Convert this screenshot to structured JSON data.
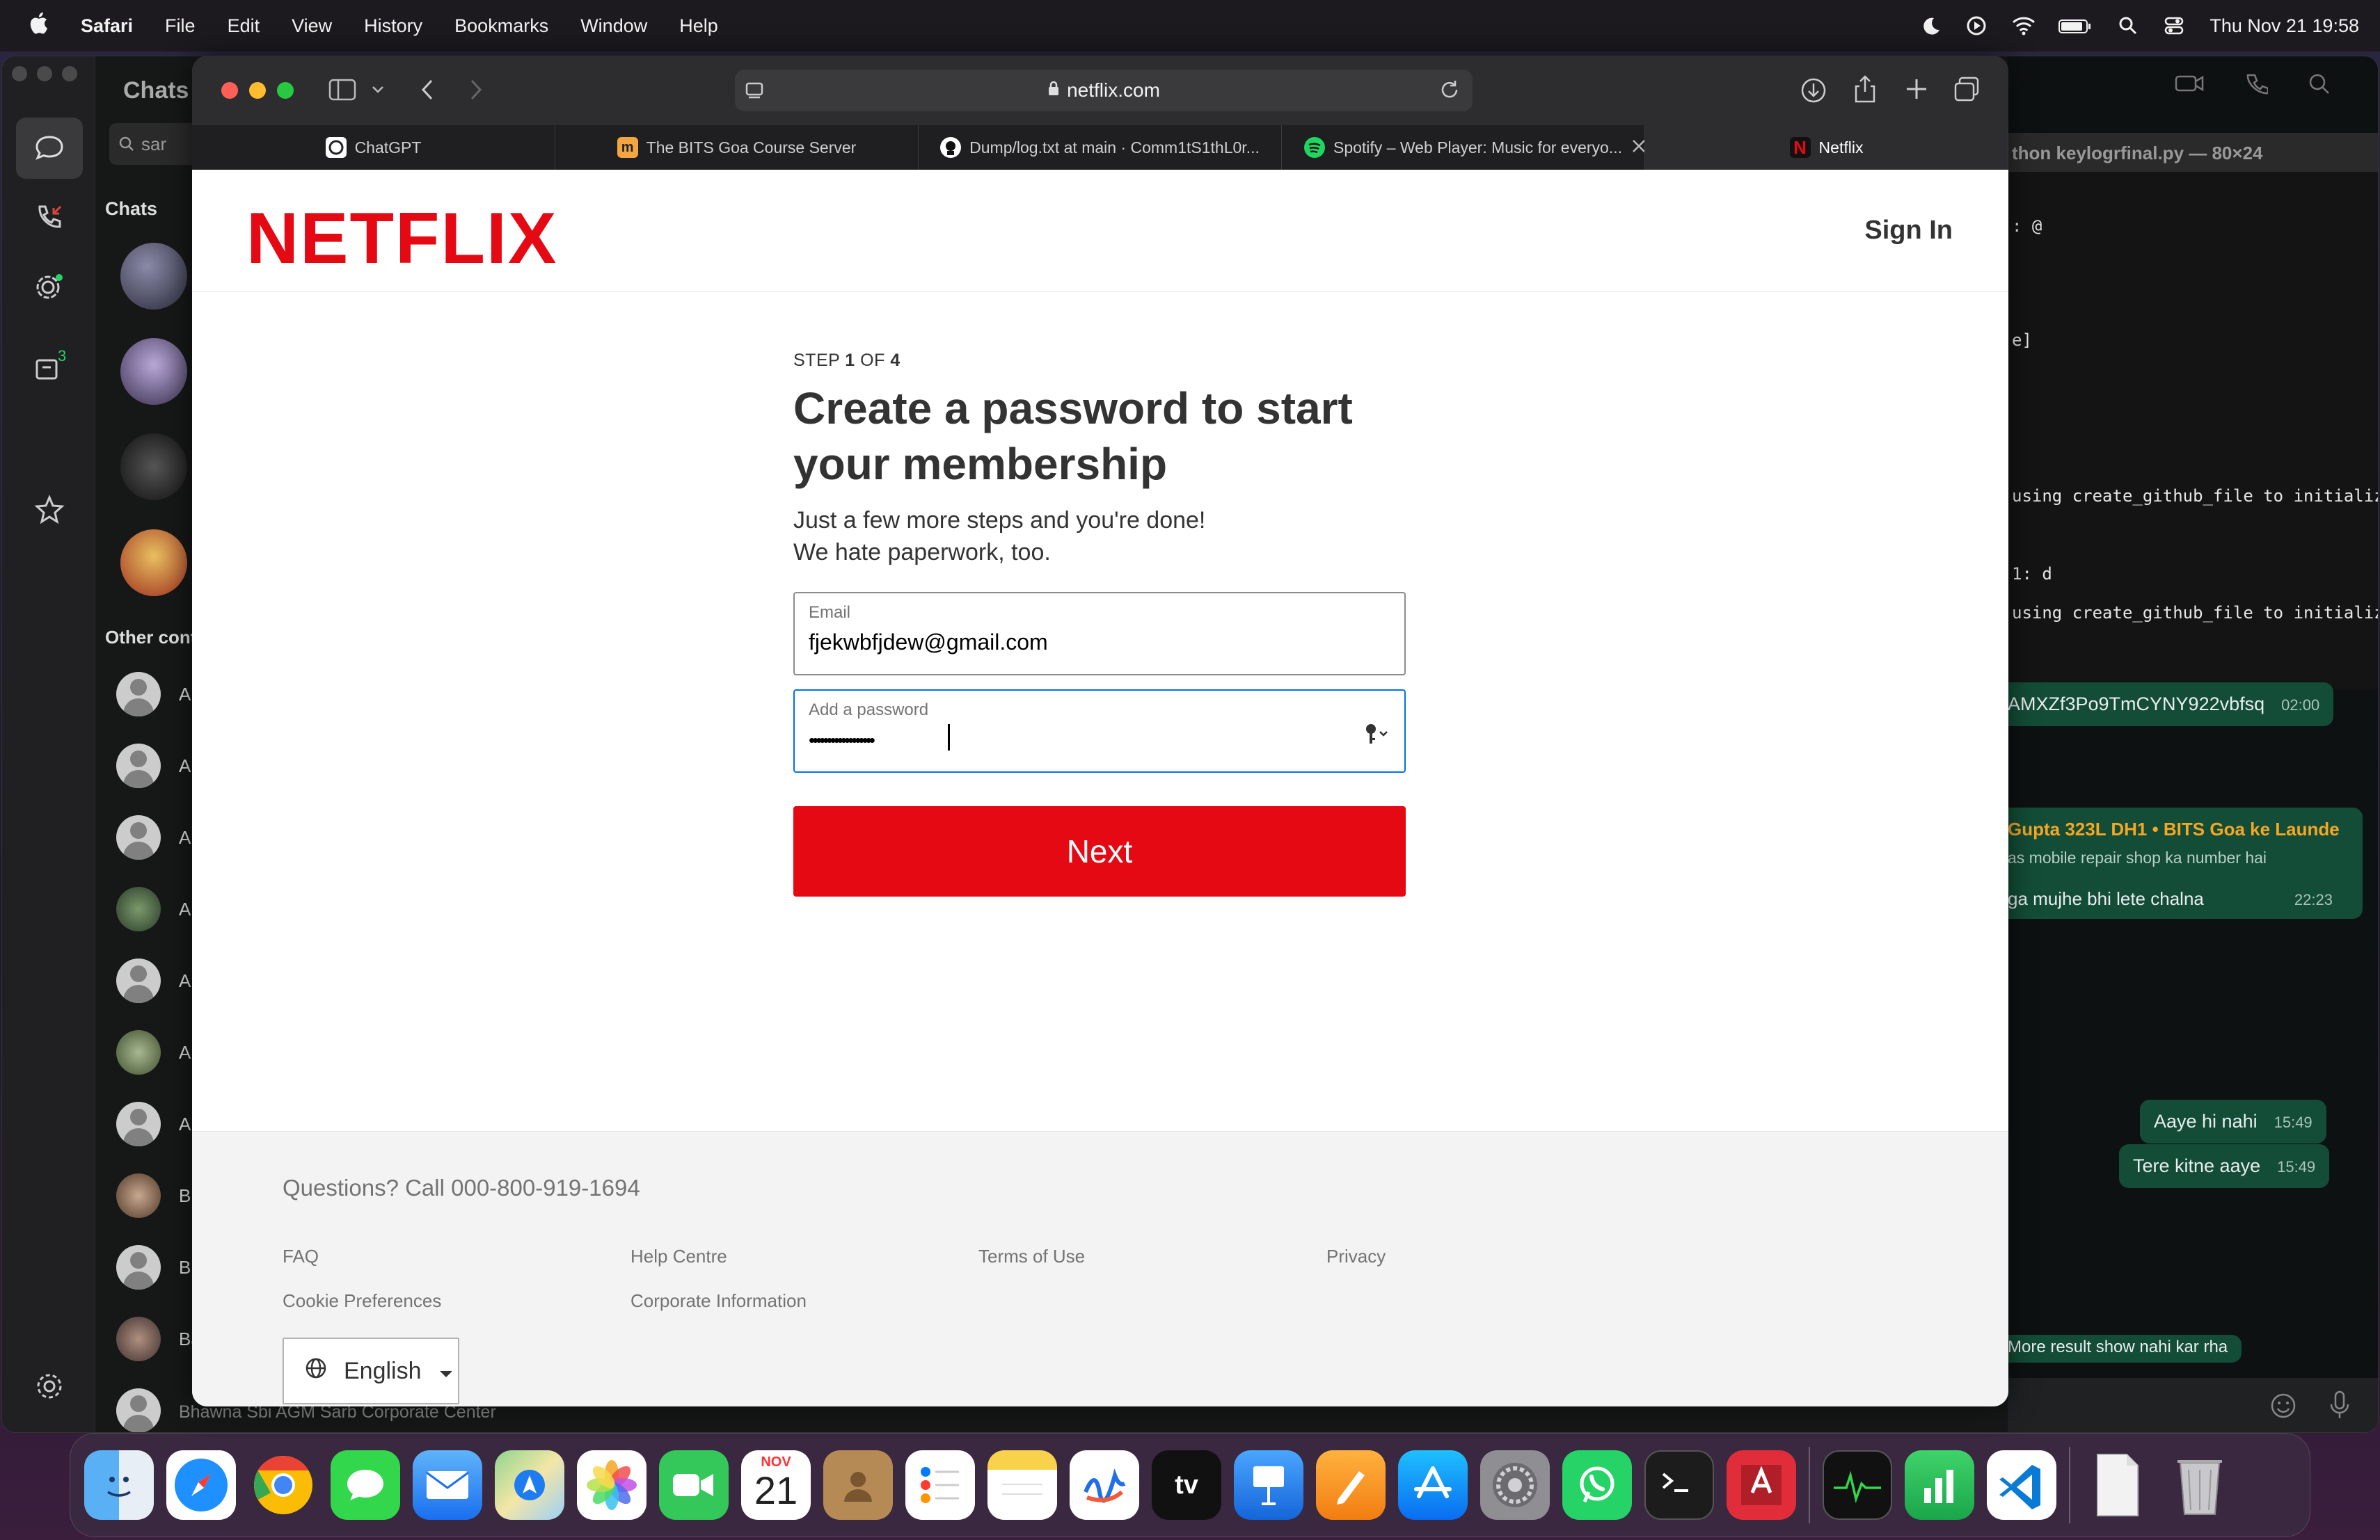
{
  "menubar": {
    "app": "Safari",
    "items": [
      "File",
      "Edit",
      "View",
      "History",
      "Bookmarks",
      "Window",
      "Help"
    ],
    "clock": "Thu Nov 21  19:58"
  },
  "whatsapp": {
    "title": "Chats",
    "search_value": "sar",
    "section_chats": "Chats",
    "section_other": "Other cont",
    "archive_badge": "3",
    "contact_initials": [
      "A",
      "A",
      "A",
      "A",
      "A",
      "A",
      "A",
      "B",
      "B",
      "Ba"
    ],
    "last_contact": "Bhawna Sbi AGM Sarb Corporate Center",
    "terminal_title": "thon keylogrfinal.py — 80×24",
    "terminal_lines": [
      ": @",
      "e]",
      " using create_github_file to initializ",
      "1: d",
      " using create_github_file to initializ"
    ],
    "messages": {
      "m1_text": "AMXZf3Po9TmCYNY922vbfsq",
      "m1_time": "02:00",
      "group_sender": "Gupta 323L DH1 • BITS Goa ke Launde",
      "group_quote": "as mobile repair shop ka number hai",
      "m2_text": "ga mujhe bhi lete chalna",
      "m2_time": "22:23",
      "m3_text": "Aaye hi nahi",
      "m3_time": "15:49",
      "m4_text": "Tere kitne aaye",
      "m4_time": "15:49",
      "m5_text": "More result show nahi kar rha"
    }
  },
  "safari": {
    "url": "netflix.com",
    "tabs": [
      {
        "label": "ChatGPT",
        "color": "#ffffff"
      },
      {
        "label": "The BITS Goa Course Server",
        "color": "#f2a541"
      },
      {
        "label": "Dump/log.txt at main · Comm1tS1thL0r...",
        "color": "#ffffff"
      },
      {
        "label": "Spotify – Web Player: Music for everyo...",
        "color": "#1ed760"
      },
      {
        "label": "Netflix",
        "color": "#e50914"
      }
    ]
  },
  "netflix": {
    "logo": "NETFLIX",
    "sign_in": "Sign In",
    "step_prefix": "STEP ",
    "step_current": "1",
    "step_of": " OF ",
    "step_total": "4",
    "headline": "Create a password to start your membership",
    "sub_line1": "Just a few more steps and you're done!",
    "sub_line2": "We hate paperwork, too.",
    "email_label": "Email",
    "email_value": "fjekwbfjdew@gmail.com",
    "password_label": "Add a password",
    "password_value": "••••••••••••••••••",
    "next_label": "Next",
    "footer": {
      "questions": "Questions? Call 000-800-919-1694",
      "links": [
        "FAQ",
        "Help Centre",
        "Terms of Use",
        "Privacy",
        "Cookie Preferences",
        "Corporate Information"
      ],
      "language": "English"
    }
  },
  "dock": {
    "calendar_month": "NOV",
    "calendar_day": "21",
    "tv_label": "tv"
  }
}
